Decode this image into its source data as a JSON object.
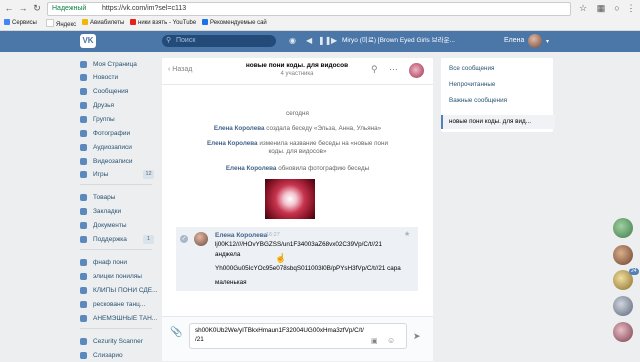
{
  "browser": {
    "secure_label": "Надежный",
    "url": "https://vk.com/im?sel=c113",
    "bookmarks": [
      {
        "label": "Сервисы",
        "color": "#4285f4"
      },
      {
        "label": "Яндекс",
        "color": "#ffffff"
      },
      {
        "label": "Авиабилеты",
        "color": "#f2b705"
      },
      {
        "label": "ники взять - YouTube",
        "color": "#e62117"
      },
      {
        "label": "Рекомендуемые сай",
        "color": "#1a73e8"
      }
    ]
  },
  "header": {
    "logo": "VK",
    "search_placeholder": "Поиск",
    "track": "Miryo (미료) [Brown Eyed Girls 브라운...",
    "user_name": "Елена"
  },
  "menu": [
    {
      "label": "Моя Страница"
    },
    {
      "label": "Новости"
    },
    {
      "label": "Сообщения"
    },
    {
      "label": "Друзья"
    },
    {
      "label": "Группы"
    },
    {
      "label": "Фотографии"
    },
    {
      "label": "Аудиозаписи"
    },
    {
      "label": "Видеозаписи"
    },
    {
      "label": "Игры",
      "count": "12"
    },
    {
      "label": "Товары"
    },
    {
      "label": "Закладки"
    },
    {
      "label": "Документы"
    },
    {
      "label": "Поддержка",
      "count": "1"
    },
    {
      "label": "фнаф пони"
    },
    {
      "label": "элицки пониляы"
    },
    {
      "label": "КЛИПЫ ПОНИ СДЕ..."
    },
    {
      "label": "ресковане танц..."
    },
    {
      "label": "АНЕМЭШНЫЕ ТАН..."
    },
    {
      "label": "Cezurity Scanner"
    },
    {
      "label": "Слизарио"
    }
  ],
  "chat": {
    "back_label": "Назад",
    "title": "новые пони коды. для видосов",
    "subtitle": "4 участника",
    "date_divider": "сегодня",
    "system_messages": [
      {
        "author": "Елена Королева",
        "text": "создала беседу «Эльза, Анна, Ульяна»"
      },
      {
        "author": "Елена Королева",
        "text": "изменила название беседы на «новые пони коды. для видосов»"
      },
      {
        "author": "Елена Королева",
        "text": "обновила фотографию беседы"
      }
    ],
    "message": {
      "author": "Елена Королева",
      "time": "16:27",
      "lines": [
        "lj00K12////HOvYBGZSS/un1F34003aZ68vx02C39Vp/C/t//21",
        "анджела",
        "Yh000Gu05IcYOc95e078sbqS011003l0B/pPYsH3fVp/C/t//21 сара",
        "маленькая"
      ]
    },
    "composer_lines": [
      "sh00K0Ub2We/yITBkxHmaun1F32004UG00xHma3zfVp/C/t/",
      "/21"
    ]
  },
  "right_panel": {
    "items": [
      "Все сообщения",
      "Непрочитанные",
      "Важные сообщения",
      "новые пони коды. для вид..."
    ]
  },
  "side_chats": {
    "counts": [
      "24"
    ]
  }
}
